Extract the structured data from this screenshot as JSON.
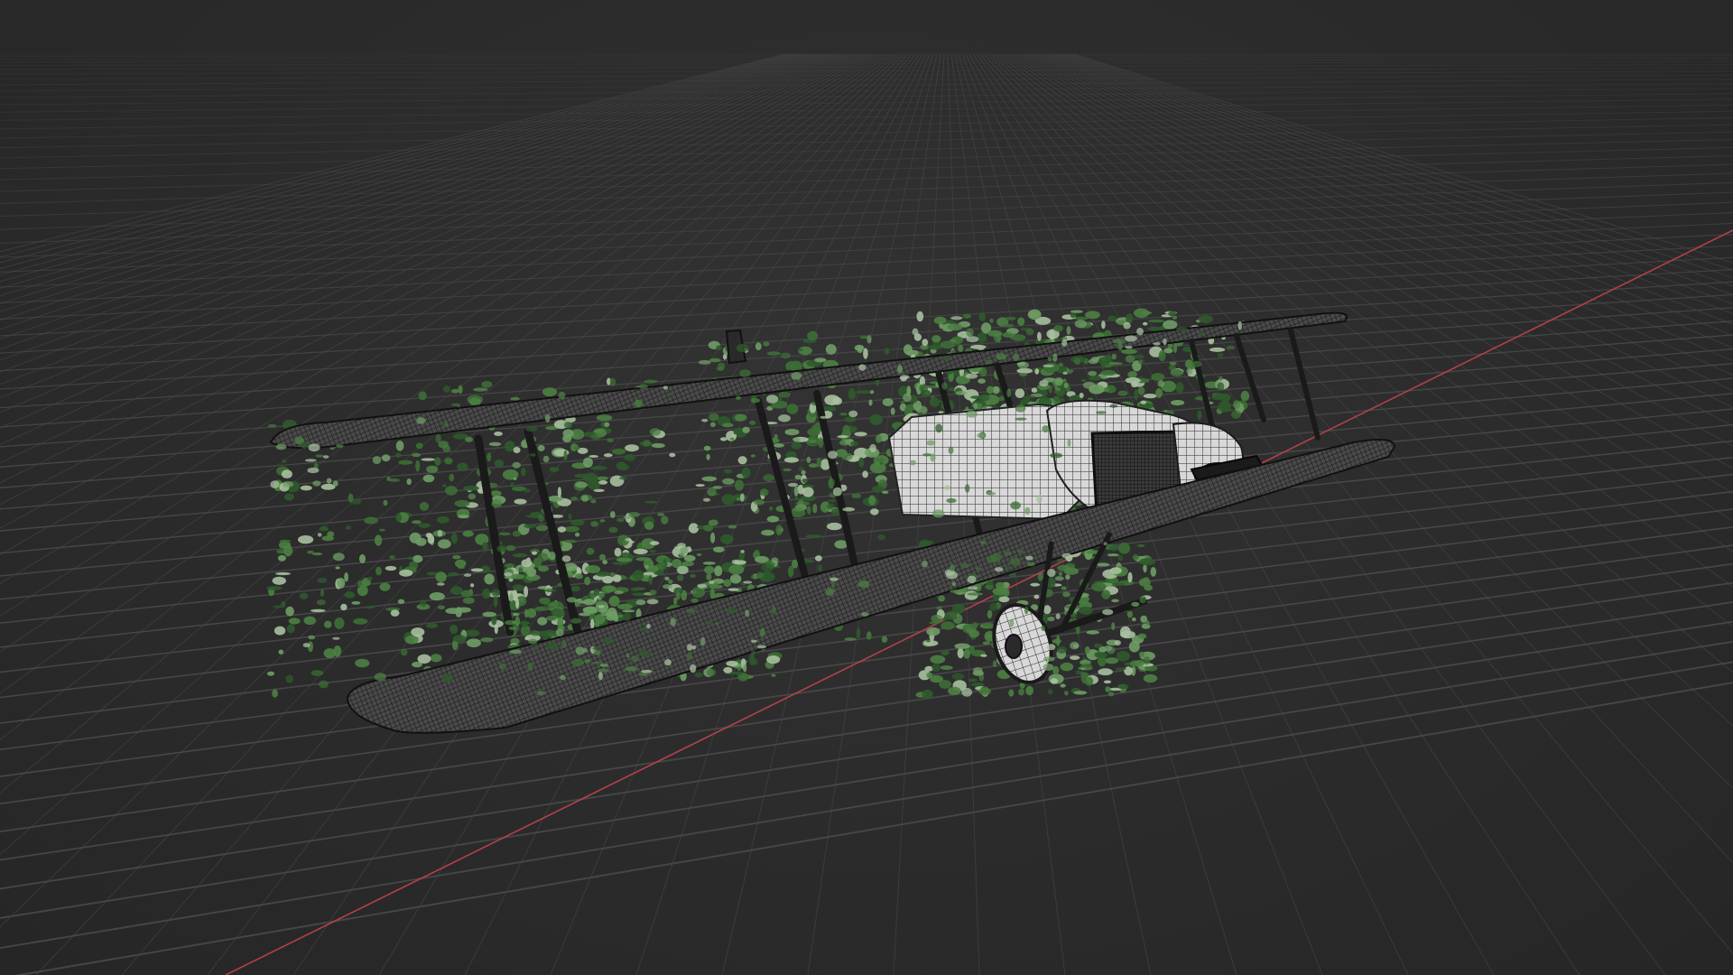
{
  "viewport": {
    "mode": "wireframe-on-shaded",
    "background": "#2d2d2d",
    "grid_color": "#4a4a4a",
    "x_axis_color": "#b3414a"
  },
  "model": {
    "kind": "biplane",
    "overlay": "ivy foliage",
    "mesh_color": "#1c1c1c",
    "fabric_color": "#cfcfcf",
    "foliage_colors": [
      "#2f5a2c",
      "#3d6e36",
      "#4c8042",
      "#6f9c66",
      "#a8c0a0"
    ]
  }
}
